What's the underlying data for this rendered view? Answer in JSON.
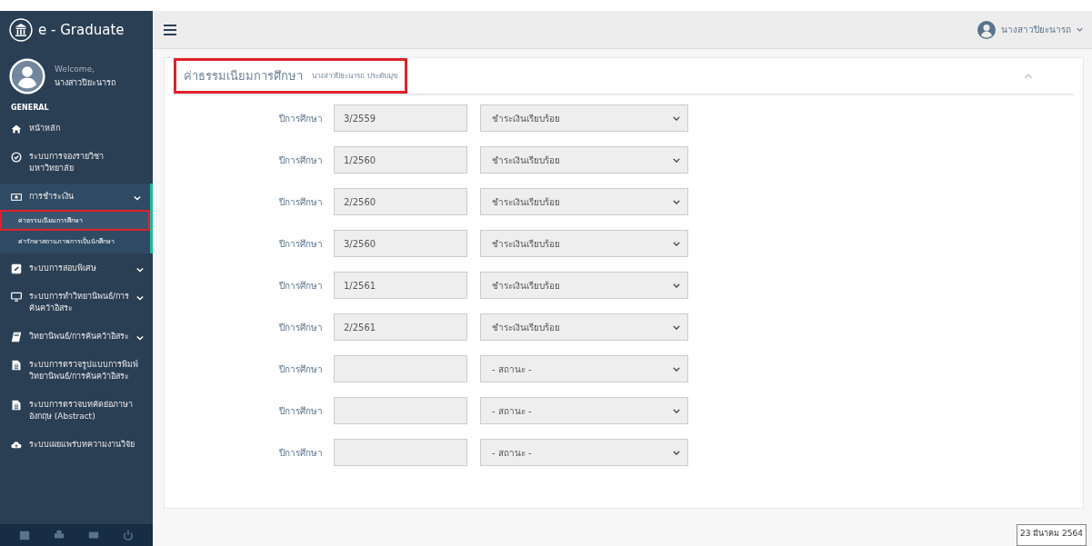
{
  "brand": {
    "title": "e - Graduate"
  },
  "profile": {
    "welcome": "Welcome,",
    "name": "นางสาวปิยะนารถ"
  },
  "sidebar": {
    "section": "GENERAL",
    "items": [
      {
        "label": "หน้าหลัก",
        "has_submenu": false,
        "expanded": false
      },
      {
        "label": "ระบบการจองรายวิชามหาวิทยาลัย",
        "has_submenu": false,
        "expanded": false
      },
      {
        "label": "การชำระเงิน",
        "has_submenu": true,
        "expanded": true,
        "children": [
          {
            "label": "ค่าธรรมเนียมการศึกษา",
            "selected": true
          },
          {
            "label": "ค่ารักษาสถานภาพการเป็นนักศึกษา",
            "selected": false
          }
        ]
      },
      {
        "label": "ระบบการสอบพิเศษ",
        "has_submenu": true,
        "expanded": false
      },
      {
        "label": "ระบบการทำวิทยานิพนธ์/การค้นคว้าอิสระ",
        "has_submenu": true,
        "expanded": false
      },
      {
        "label": "วิทยานิพนธ์/การค้นคว้าอิสระ",
        "has_submenu": true,
        "expanded": false
      },
      {
        "label": "ระบบการตรวจรูปแบบการพิมพ์วิทยานิพนธ์/การค้นคว้าอิสระ",
        "has_submenu": false,
        "expanded": false
      },
      {
        "label": "ระบบการตรวจบทคัดย่อภาษาอังกฤษ (Abstract)",
        "has_submenu": false,
        "expanded": false
      },
      {
        "label": "ระบบเผยแพร่บทความงานวิจัย",
        "has_submenu": false,
        "expanded": false
      }
    ]
  },
  "topbar": {
    "user": "นางสาวปิยะนารถ"
  },
  "panel": {
    "title": "ค่าธรรมเนียมการศึกษา",
    "subtitle": "นางสาวปิยะนารถ ประดับมุข",
    "highlighted": true,
    "rows": [
      {
        "label": "ปีการศึกษา",
        "year": "3/2559",
        "status": "ชำระเงินเรียบร้อย"
      },
      {
        "label": "ปีการศึกษา",
        "year": "1/2560",
        "status": "ชำระเงินเรียบร้อย"
      },
      {
        "label": "ปีการศึกษา",
        "year": "2/2560",
        "status": "ชำระเงินเรียบร้อย"
      },
      {
        "label": "ปีการศึกษา",
        "year": "3/2560",
        "status": "ชำระเงินเรียบร้อย"
      },
      {
        "label": "ปีการศึกษา",
        "year": "1/2561",
        "status": "ชำระเงินเรียบร้อย"
      },
      {
        "label": "ปีการศึกษา",
        "year": "2/2561",
        "status": "ชำระเงินเรียบร้อย"
      },
      {
        "label": "ปีการศึกษา",
        "year": "",
        "status": "- สถานะ -"
      },
      {
        "label": "ปีการศึกษา",
        "year": "",
        "status": "- สถานะ -"
      },
      {
        "label": "ปีการศึกษา",
        "year": "",
        "status": "- สถานะ -"
      }
    ]
  },
  "date_tooltip": "23 มีนาคม 2564"
}
